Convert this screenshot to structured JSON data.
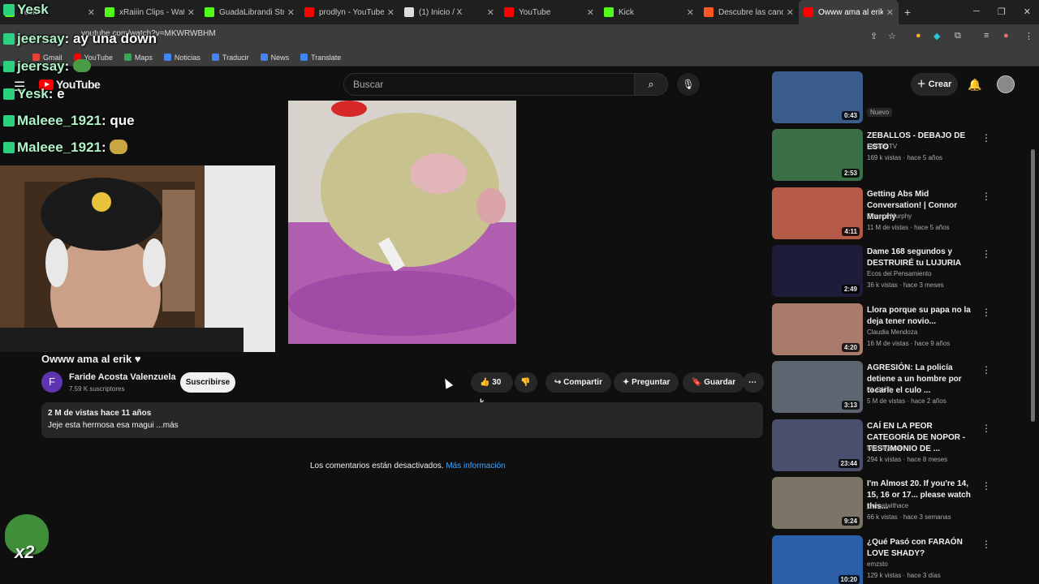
{
  "browser": {
    "tabs": [
      {
        "title": "Yesk",
        "favicon_color": "#53fc18"
      },
      {
        "title": "xRaiiin Clips - Watch",
        "favicon_color": "#53fc18"
      },
      {
        "title": "GuadaLibrandi Stream",
        "favicon_color": "#53fc18"
      },
      {
        "title": "prodlyn - YouTube",
        "favicon_color": "#ff0000"
      },
      {
        "title": "(1) Inicio / X",
        "favicon_color": "#dddddd"
      },
      {
        "title": "YouTube",
        "favicon_color": "#ff0000"
      },
      {
        "title": "Kick",
        "favicon_color": "#53fc18"
      },
      {
        "title": "Descubre las cancion",
        "favicon_color": "#ff5722"
      },
      {
        "title": "Owww ama al erik ♥",
        "favicon_color": "#ff0000"
      }
    ],
    "new_tab": "+",
    "url": "youtube.com/watch?v=MKWRWBHM",
    "bookmarks": [
      {
        "label": "Gmail",
        "color": "#ea4335"
      },
      {
        "label": "YouTube",
        "color": "#ff0000"
      },
      {
        "label": "Maps",
        "color": "#34a853"
      },
      {
        "label": "Noticias",
        "color": "#4285f4"
      },
      {
        "label": "Traducir",
        "color": "#4285f4"
      },
      {
        "label": "News",
        "color": "#4285f4"
      },
      {
        "label": "Translate",
        "color": "#4285f4"
      }
    ]
  },
  "youtube": {
    "logo_text": "YouTube",
    "search_placeholder": "Buscar",
    "create_label": "Crear"
  },
  "chat_overlay": [
    {
      "user": "jeersay",
      "message": "ay una down"
    },
    {
      "user": "jeersay",
      "message": ""
    },
    {
      "user": "Yesk",
      "message": "e"
    },
    {
      "user": "Maleee_1921",
      "message": "que"
    },
    {
      "user": "Maleee_1921",
      "message": ""
    }
  ],
  "video": {
    "title": "Owww ama al erik ♥",
    "channel_initial": "F",
    "channel_name": "Faride Acosta Valenzuela",
    "subscribers": "7.59 K suscriptores",
    "subscribe_label": "Suscribirse",
    "likes": "30 k",
    "share_label": "Compartir",
    "ask_label": "Preguntar",
    "save_label": "Guardar",
    "views_date": "2 M de vistas  hace 11 años",
    "description": "Jeje esta hermosa esa magui ...más",
    "comments_off": "Los comentarios están desactivados.",
    "more_info": "Más información"
  },
  "recommendations": [
    {
      "title": "",
      "channel": "",
      "meta": "Nuevo",
      "duration": "0:43",
      "thumb": "#3a5d8c"
    },
    {
      "title": "ZEBALLOS - DEBAJO DE ESTO",
      "channel": "Stelars TV",
      "meta": "169 k vistas · hace 5 años",
      "duration": "2:53",
      "thumb": "#3b6f45"
    },
    {
      "title": "Getting Abs Mid Conversation! | Connor Murphy",
      "channel": "Connor Murphy",
      "meta": "11 M de vistas · hace 5 años",
      "duration": "4:11",
      "thumb": "#b65a48"
    },
    {
      "title": "Dame 168 segundos y DESTRUIRÉ tu LUJURIA",
      "channel": "Ecos del Pensamiento",
      "meta": "36 k vistas · hace 3 meses",
      "duration": "2:49",
      "thumb": "#1d1d3a"
    },
    {
      "title": "Llora porque su papa no la deja tener novio...",
      "channel": "Claudia Mendoza",
      "meta": "16 M de vistas · hace 9 años",
      "duration": "4:20",
      "thumb": "#a87b6c"
    },
    {
      "title": "AGRESIÓN: La policía detiene a un hombre por tocarle el culo ...",
      "channel": "EL PAÍS",
      "meta": "5 M de vistas · hace 2 años",
      "duration": "3:13",
      "thumb": "#5c6570"
    },
    {
      "title": "CAÍ EN LA PEOR CATEGORÍA DE NOPOR - TESTIMONIO DE ...",
      "channel": "IvanTeysera",
      "meta": "294 k vistas · hace 8 meses",
      "duration": "23:44",
      "thumb": "#4b4f6e"
    },
    {
      "title": "I'm Almost 20. If you're 14, 15, 16 or 17... please watch this...",
      "channel": "journalwithace",
      "meta": "66 k vistas · hace 3 semanas",
      "duration": "9:24",
      "thumb": "#7d7468"
    },
    {
      "title": "¿Qué Pasó con FARAÓN LOVE SHADY?",
      "channel": "emzsto",
      "meta": "129 k vistas · hace 3 días",
      "duration": "10:20",
      "thumb": "#2a5fa8"
    }
  ],
  "emote_count": "x2"
}
